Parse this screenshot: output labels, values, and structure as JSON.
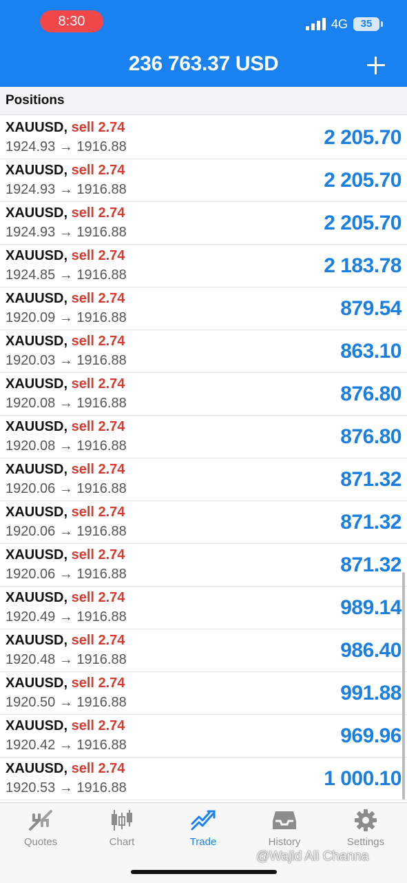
{
  "status_bar": {
    "time": "8:30",
    "network": "4G",
    "battery": "35"
  },
  "header": {
    "balance": "236 763.37 USD"
  },
  "section": {
    "title": "Positions"
  },
  "positions": [
    {
      "symbol": "XAUUSD,",
      "side": "sell 2.74",
      "prices": "1924.93 → 1916.88",
      "profit": "2 205.70"
    },
    {
      "symbol": "XAUUSD,",
      "side": "sell 2.74",
      "prices": "1924.93 → 1916.88",
      "profit": "2 205.70"
    },
    {
      "symbol": "XAUUSD,",
      "side": "sell 2.74",
      "prices": "1924.93 → 1916.88",
      "profit": "2 205.70"
    },
    {
      "symbol": "XAUUSD,",
      "side": "sell 2.74",
      "prices": "1924.85 → 1916.88",
      "profit": "2 183.78"
    },
    {
      "symbol": "XAUUSD,",
      "side": "sell 2.74",
      "prices": "1920.09 → 1916.88",
      "profit": "879.54"
    },
    {
      "symbol": "XAUUSD,",
      "side": "sell 2.74",
      "prices": "1920.03 → 1916.88",
      "profit": "863.10"
    },
    {
      "symbol": "XAUUSD,",
      "side": "sell 2.74",
      "prices": "1920.08 → 1916.88",
      "profit": "876.80"
    },
    {
      "symbol": "XAUUSD,",
      "side": "sell 2.74",
      "prices": "1920.08 → 1916.88",
      "profit": "876.80"
    },
    {
      "symbol": "XAUUSD,",
      "side": "sell 2.74",
      "prices": "1920.06 → 1916.88",
      "profit": "871.32"
    },
    {
      "symbol": "XAUUSD,",
      "side": "sell 2.74",
      "prices": "1920.06 → 1916.88",
      "profit": "871.32"
    },
    {
      "symbol": "XAUUSD,",
      "side": "sell 2.74",
      "prices": "1920.06 → 1916.88",
      "profit": "871.32"
    },
    {
      "symbol": "XAUUSD,",
      "side": "sell 2.74",
      "prices": "1920.49 → 1916.88",
      "profit": "989.14"
    },
    {
      "symbol": "XAUUSD,",
      "side": "sell 2.74",
      "prices": "1920.48 → 1916.88",
      "profit": "986.40"
    },
    {
      "symbol": "XAUUSD,",
      "side": "sell 2.74",
      "prices": "1920.50 → 1916.88",
      "profit": "991.88"
    },
    {
      "symbol": "XAUUSD,",
      "side": "sell 2.74",
      "prices": "1920.42 → 1916.88",
      "profit": "969.96"
    },
    {
      "symbol": "XAUUSD,",
      "side": "sell 2.74",
      "prices": "1920.53 → 1916.88",
      "profit": "1 000.10"
    }
  ],
  "tabs": [
    {
      "label": "Quotes",
      "icon": "quotes-icon",
      "active": false
    },
    {
      "label": "Chart",
      "icon": "chart-candles-icon",
      "active": false
    },
    {
      "label": "Trade",
      "icon": "trade-icon",
      "active": true
    },
    {
      "label": "History",
      "icon": "history-tray-icon",
      "active": false
    },
    {
      "label": "Settings",
      "icon": "gear-icon",
      "active": false
    }
  ],
  "watermark": "@Wajid Ali Channa",
  "colors": {
    "header_blue": "#1a82f0",
    "sell_red": "#d63a2f",
    "profit_blue": "#1a7fe0",
    "time_pill_red": "#f0484a",
    "tab_inactive": "#8c8c8c"
  }
}
